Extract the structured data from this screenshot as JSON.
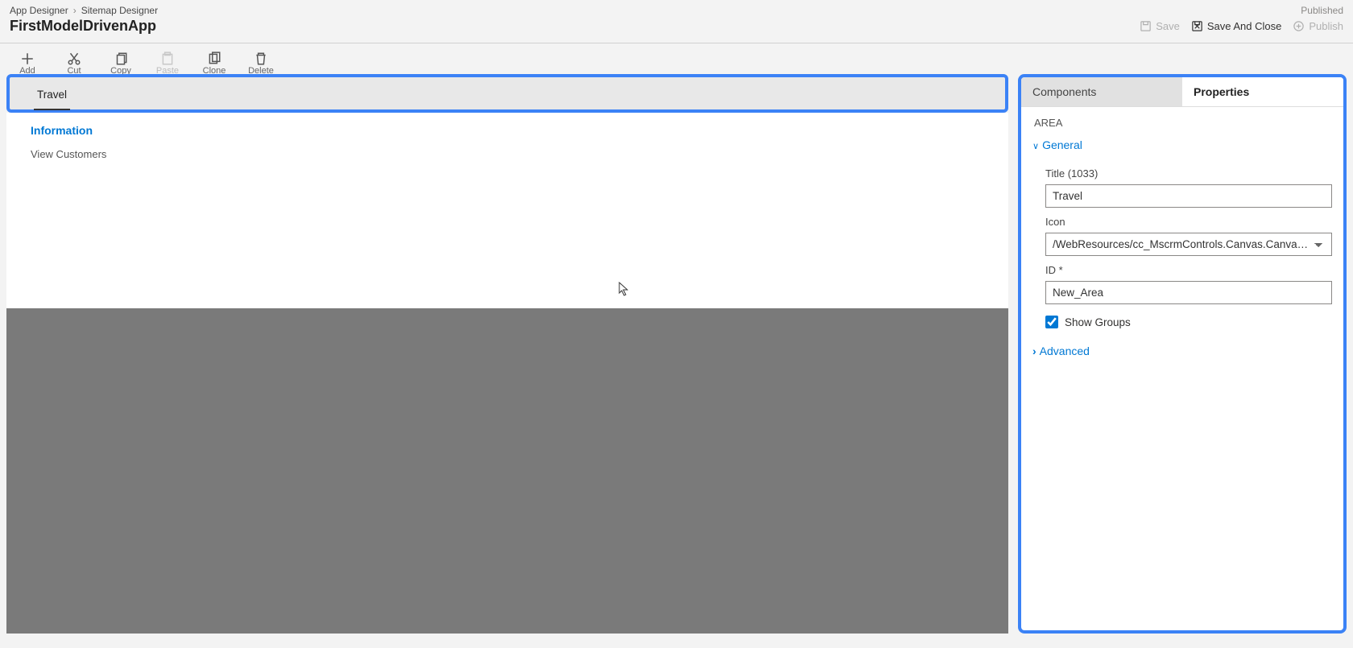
{
  "breadcrumbs": {
    "item1": "App Designer",
    "item2": "Sitemap Designer"
  },
  "appTitle": "FirstModelDrivenApp",
  "publishStatus": "Published",
  "headerActions": {
    "save": "Save",
    "saveAndClose": "Save And Close",
    "publish": "Publish"
  },
  "toolbar": {
    "add": "Add",
    "cut": "Cut",
    "copy": "Copy",
    "paste": "Paste",
    "clone": "Clone",
    "delete": "Delete"
  },
  "canvas": {
    "areaTab": "Travel",
    "groupTitle": "Information",
    "subareaTitle": "View Customers"
  },
  "rightPane": {
    "tabComponents": "Components",
    "tabProperties": "Properties",
    "sectionTitle": "AREA",
    "generalHeader": "General",
    "advancedHeader": "Advanced",
    "fields": {
      "titleLabel": "Title (1033)",
      "titleValue": "Travel",
      "iconLabel": "Icon",
      "iconValue": "/WebResources/cc_MscrmControls.Canvas.CanvasRecordCon",
      "idLabel": "ID *",
      "idValue": "New_Area",
      "showGroupsLabel": "Show Groups",
      "showGroupsChecked": true
    }
  }
}
